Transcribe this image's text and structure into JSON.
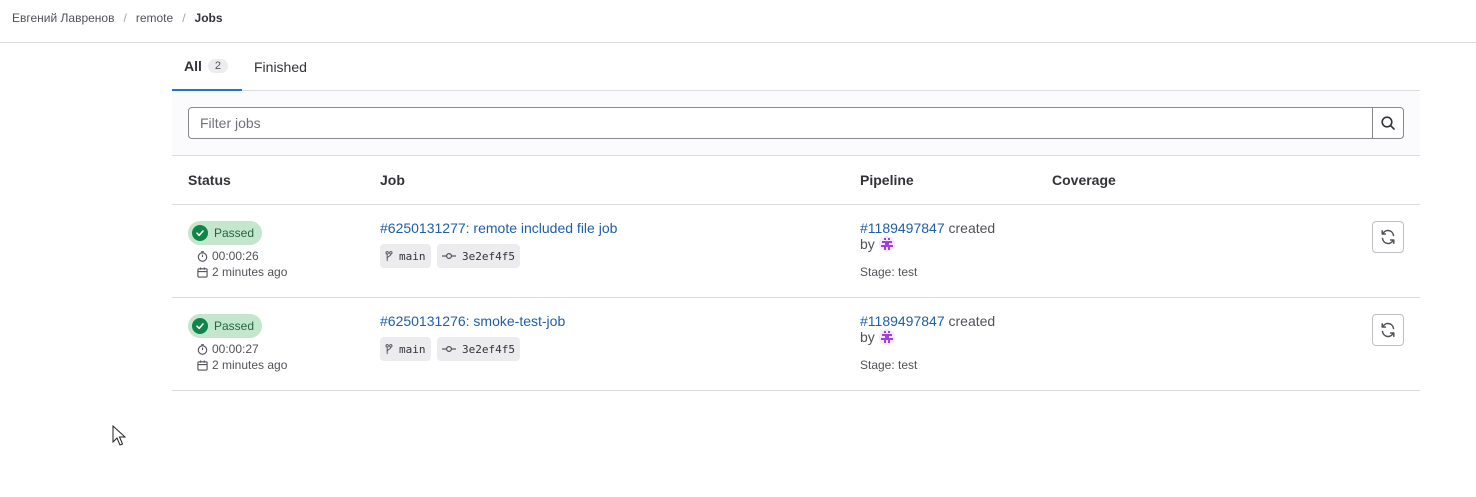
{
  "breadcrumb": {
    "user": "Евгений Лавренов",
    "project": "remote",
    "current": "Jobs"
  },
  "tabs": {
    "all_label": "All",
    "all_count": "2",
    "finished_label": "Finished"
  },
  "filter": {
    "placeholder": "Filter jobs"
  },
  "columns": {
    "status": "Status",
    "job": "Job",
    "pipeline": "Pipeline",
    "coverage": "Coverage"
  },
  "jobs": [
    {
      "status": "Passed",
      "duration": "00:00:26",
      "finished": "2 minutes ago",
      "title": "#6250131277: remote included file job",
      "ref": "main",
      "commit": "3e2ef4f5",
      "pipeline_id": "#1189497847",
      "created": "created",
      "by": "by",
      "stage": "Stage: test"
    },
    {
      "status": "Passed",
      "duration": "00:00:27",
      "finished": "2 minutes ago",
      "title": "#6250131276: smoke-test-job",
      "ref": "main",
      "commit": "3e2ef4f5",
      "pipeline_id": "#1189497847",
      "created": "created",
      "by": "by",
      "stage": "Stage: test"
    }
  ],
  "colors": {
    "accent": "#1f75cb",
    "link": "#1f5ea8",
    "success_bg": "#c3e6cd",
    "success_fg": "#24663b",
    "success_icon": "#108548"
  },
  "icons": [
    "search-icon",
    "check-circle-icon",
    "timer-icon",
    "calendar-icon",
    "branch-icon",
    "commit-icon",
    "avatar-icon",
    "retry-icon",
    "mouse-cursor-icon"
  ]
}
